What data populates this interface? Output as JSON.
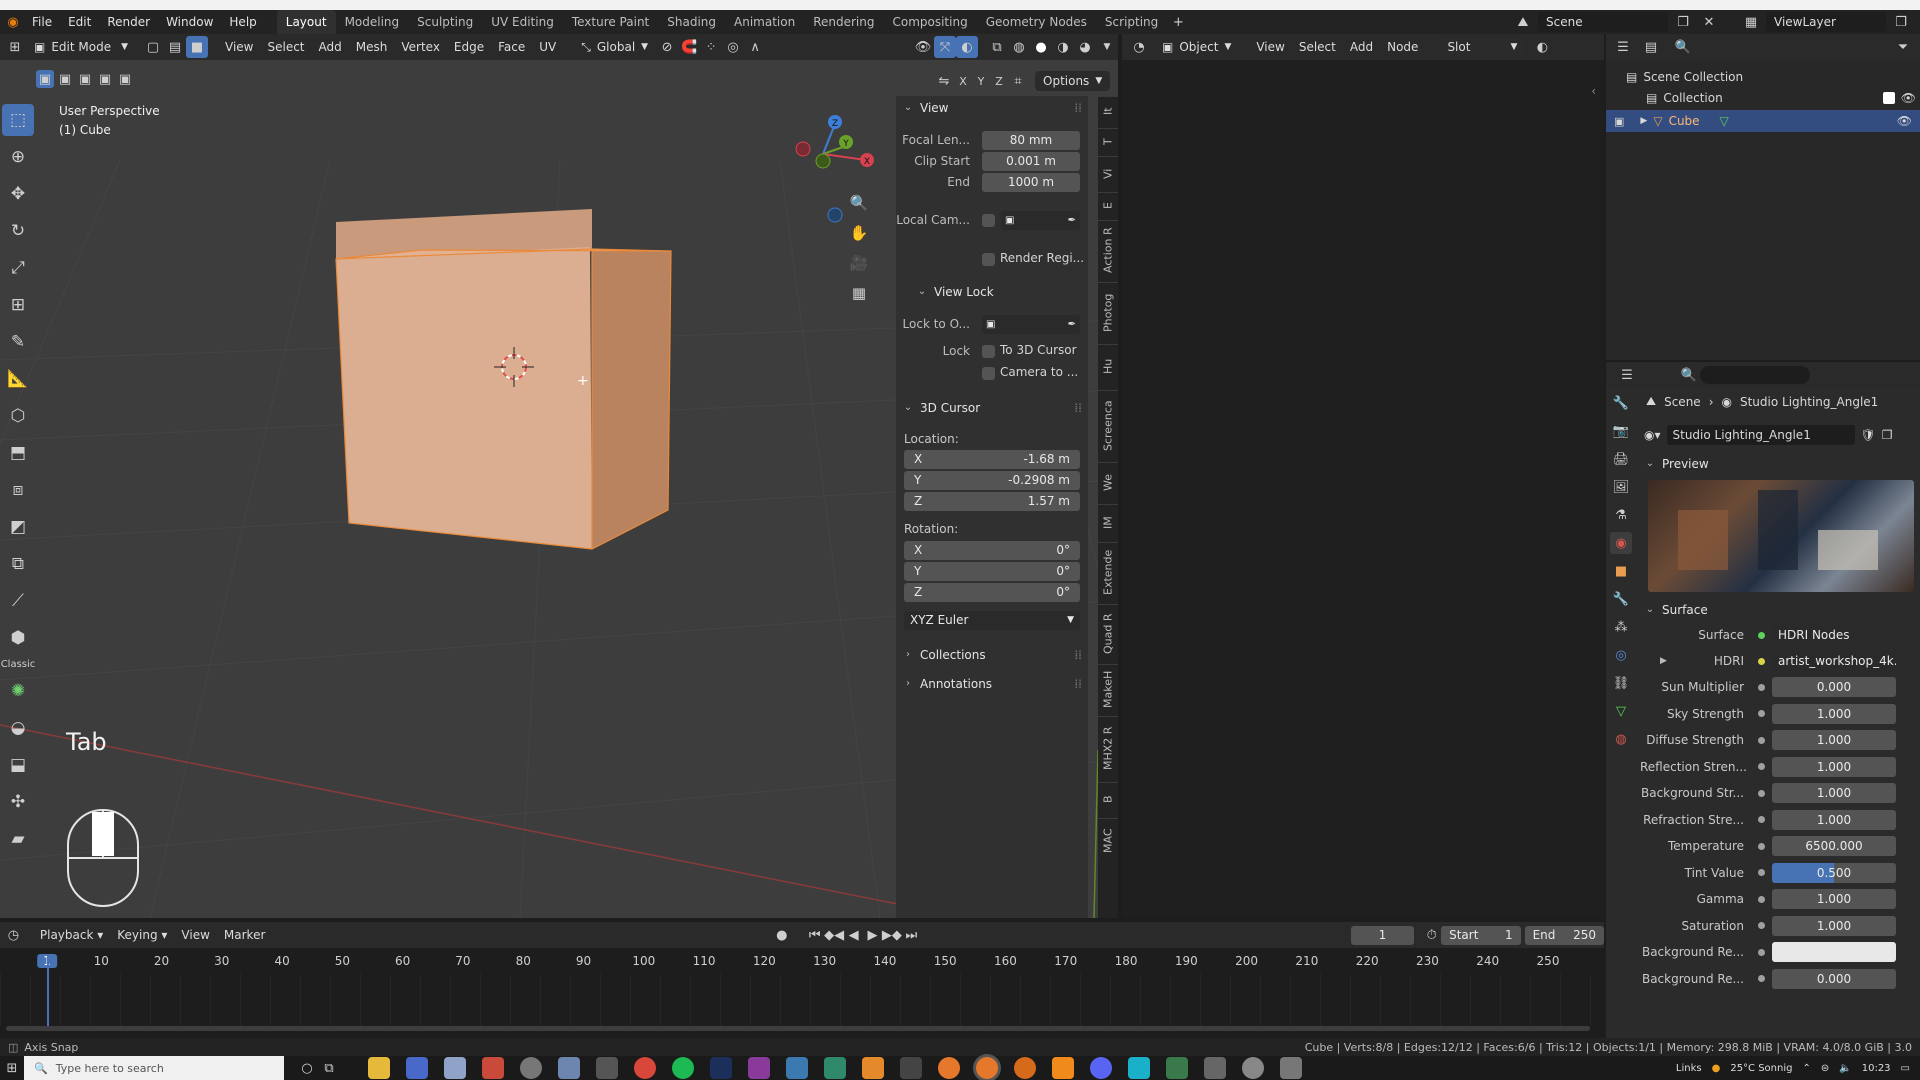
{
  "top_menu": [
    "File",
    "Edit",
    "Render",
    "Window",
    "Help"
  ],
  "workspace_tabs": [
    "Layout",
    "Modeling",
    "Sculpting",
    "UV Editing",
    "Texture Paint",
    "Shading",
    "Animation",
    "Rendering",
    "Compositing",
    "Geometry Nodes",
    "Scripting"
  ],
  "scene_name": "Scene",
  "view_layer": "ViewLayer",
  "viewport_header": {
    "mode": "Edit Mode",
    "menus": [
      "View",
      "Select",
      "Add",
      "Mesh",
      "Vertex",
      "Edge",
      "Face",
      "UV"
    ],
    "orientation": "Global",
    "options": "Options",
    "axes": [
      "X",
      "Y",
      "Z"
    ]
  },
  "viewport": {
    "perspective": "User Perspective",
    "object": "(1) Cube",
    "key_overlay": "Tab",
    "gizmo_axes": {
      "x": "X",
      "y": "Y",
      "z": "Z"
    }
  },
  "n_panel": {
    "view": {
      "title": "View",
      "focal_label": "Focal Len...",
      "focal_value": "80 mm",
      "clip_start_label": "Clip Start",
      "clip_start_value": "0.001 m",
      "end_label": "End",
      "end_value": "1000 m",
      "local_cam_label": "Local Cam...",
      "render_region": "Render Regi..."
    },
    "view_lock": {
      "title": "View Lock",
      "lock_to_label": "Lock to O...",
      "lock_label": "Lock",
      "to_3d_cursor": "To 3D Cursor",
      "camera_to": "Camera to ..."
    },
    "cursor": {
      "title": "3D Cursor",
      "location_label": "Location:",
      "loc": [
        {
          "axis": "X",
          "value": "-1.68 m"
        },
        {
          "axis": "Y",
          "value": "-0.2908 m"
        },
        {
          "axis": "Z",
          "value": "1.57 m"
        }
      ],
      "rotation_label": "Rotation:",
      "rot": [
        {
          "axis": "X",
          "value": "0°"
        },
        {
          "axis": "Y",
          "value": "0°"
        },
        {
          "axis": "Z",
          "value": "0°"
        }
      ],
      "euler": "XYZ Euler"
    },
    "collections": "Collections",
    "annotations": "Annotations",
    "side_tabs": [
      "It",
      "T",
      "Vi",
      "E",
      "Action R",
      "Photog",
      "Hu",
      "Screenca",
      "We",
      "IM",
      "Extende",
      "Quad R",
      "MakeH",
      "MHX2 R",
      "B",
      "MAC"
    ]
  },
  "node_header": {
    "object": "Object",
    "menus": [
      "View",
      "Select",
      "Add",
      "Node"
    ],
    "slot": "Slot"
  },
  "outliner": {
    "root": "Scene Collection",
    "collection": "Collection",
    "cube": "Cube"
  },
  "properties": {
    "breadcrumb_scene": "Scene",
    "breadcrumb_world": "Studio Lighting_Angle1",
    "world_name": "Studio Lighting_Angle1",
    "preview_label": "Preview",
    "surface_label": "Surface",
    "surface_row_label": "Surface",
    "surface_value": "HDRI Nodes",
    "hdri_label": "HDRI",
    "hdri_value": "artist_workshop_4k....",
    "rows": [
      {
        "label": "Sun Multiplier",
        "value": "0.000"
      },
      {
        "label": "Sky Strength",
        "value": "1.000"
      },
      {
        "label": "Diffuse Strength",
        "value": "1.000"
      },
      {
        "label": "Reflection Stren...",
        "value": "1.000"
      },
      {
        "label": "Background Str...",
        "value": "1.000"
      },
      {
        "label": "Refraction Stre...",
        "value": "1.000"
      },
      {
        "label": "Temperature",
        "value": "6500.000"
      },
      {
        "label": "Tint Value",
        "value": "0.500"
      },
      {
        "label": "Gamma",
        "value": "1.000"
      },
      {
        "label": "Saturation",
        "value": "1.000"
      },
      {
        "label": "Background Re...",
        "value": ""
      },
      {
        "label": "Background Re...",
        "value": "0.000"
      }
    ]
  },
  "timeline": {
    "menus": [
      "Playback",
      "Keying",
      "View",
      "Marker"
    ],
    "current_frame": "1",
    "start_label": "Start",
    "start_value": "1",
    "end_label": "End",
    "end_value": "250",
    "ticks": [
      "1",
      "10",
      "20",
      "30",
      "40",
      "50",
      "60",
      "70",
      "80",
      "90",
      "100",
      "110",
      "120",
      "130",
      "140",
      "150",
      "160",
      "170",
      "180",
      "190",
      "200",
      "210",
      "220",
      "230",
      "240",
      "250"
    ]
  },
  "status_bar": {
    "left": "Axis Snap",
    "right": "Cube | Verts:8/8 | Edges:12/12 | Faces:6/6 | Tris:12 | Objects:1/1 | Memory: 298.8 MiB | VRAM: 4.0/8.0 GiB | 3.0"
  },
  "taskbar": {
    "search_placeholder": "Type here to search",
    "links": "Links",
    "weather": "25°C Sonnig",
    "time": "10:23"
  },
  "colors": {
    "accent_blue": "#4772b3",
    "cube_face": "#d9a98a",
    "cube_side": "#b98463",
    "selected_row": "#334d80"
  }
}
